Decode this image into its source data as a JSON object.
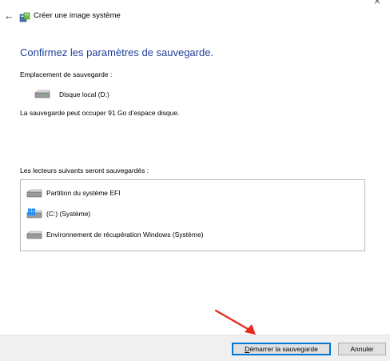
{
  "window": {
    "title": "Créer une image système",
    "close_glyph": "×",
    "back_glyph": "←"
  },
  "main": {
    "heading": "Confirmez les paramètres de sauvegarde.",
    "location_label": "Emplacement de sauvegarde :",
    "location_value": "Disque local (D:)",
    "space_text": "La sauvegarde peut occuper 91 Go d’espace disque.",
    "drives_label": "Les lecteurs suivants seront sauvegardés :",
    "drives": [
      {
        "label": "Partition du système EFI",
        "icon": "drive-icon"
      },
      {
        "label": "(C:) (Système)",
        "icon": "windows-drive-icon"
      },
      {
        "label": "Environnement de récupération Windows (Système)",
        "icon": "drive-icon"
      }
    ]
  },
  "footer": {
    "start_label_accel": "D",
    "start_label_rest": "émarrer la sauvegarde",
    "cancel_label": "Annuler"
  },
  "colors": {
    "heading": "#1f3f9a",
    "annotation_arrow": "#e8281e",
    "footer_bg": "#f0f0f0"
  }
}
